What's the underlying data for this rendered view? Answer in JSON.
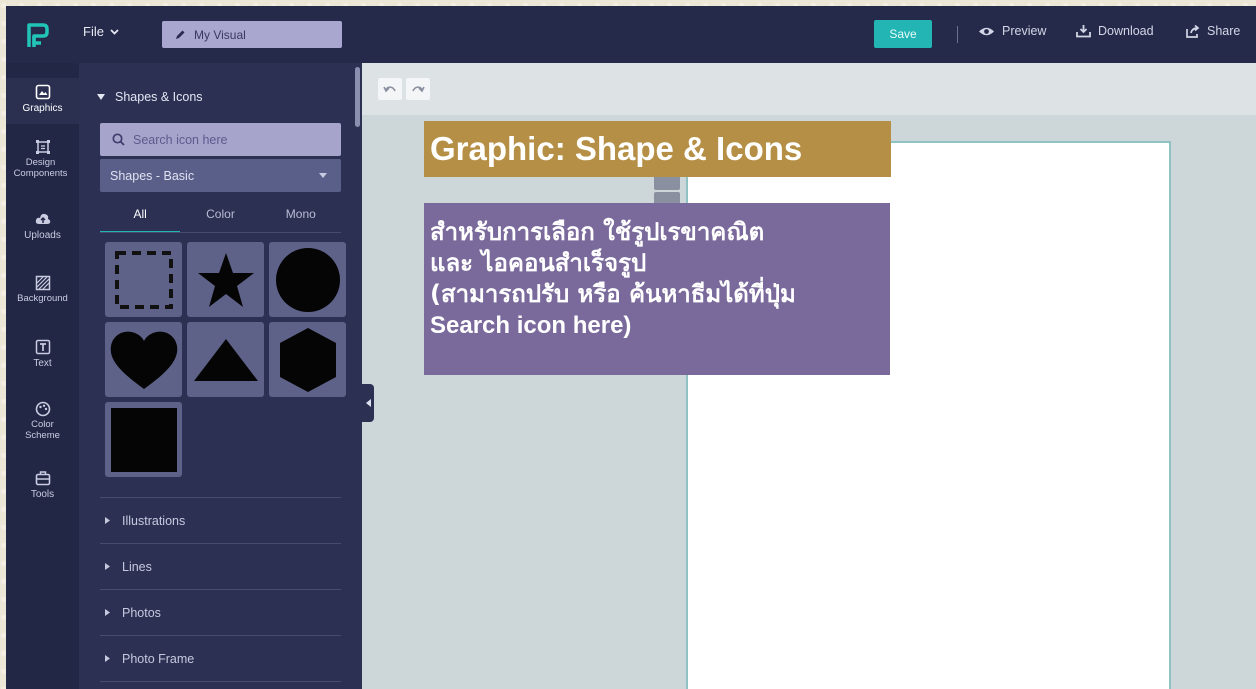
{
  "topbar": {
    "file_label": "File",
    "document_title": "My Visual",
    "save_label": "Save",
    "preview_label": "Preview",
    "download_label": "Download",
    "share_label": "Share"
  },
  "rail": {
    "items": [
      {
        "label": "Graphics",
        "icon": "image-icon"
      },
      {
        "label": "Design Components",
        "icon": "components-icon"
      },
      {
        "label": "Uploads",
        "icon": "cloud-upload-icon"
      },
      {
        "label": "Background",
        "icon": "background-icon"
      },
      {
        "label": "Text",
        "icon": "text-icon"
      },
      {
        "label": "Color Scheme",
        "icon": "palette-icon"
      },
      {
        "label": "Tools",
        "icon": "toolbox-icon"
      }
    ]
  },
  "panel": {
    "section_title": "Shapes & Icons",
    "search_placeholder": "Search icon here",
    "selected_category": "Shapes - Basic",
    "filter_tabs": [
      "All",
      "Color",
      "Mono"
    ],
    "active_filter": "All",
    "shapes": [
      "dashed-square",
      "star",
      "circle",
      "heart",
      "triangle",
      "hexagon",
      "square"
    ],
    "accordion": [
      "Illustrations",
      "Lines",
      "Photos",
      "Photo Frame"
    ]
  },
  "annotation": {
    "title": "Graphic: Shape & Icons",
    "lines": [
      "สำหรับการเลือก ใช้รูปเรขาคณิต",
      "และ ไอคอนสำเร็จรูป",
      "(สามารถปรับ หรือ ค้นหาธีมได้ที่ปุ่ม",
      "Search icon here)"
    ]
  },
  "colors": {
    "topbar_bg": "#252a4a",
    "panel_bg": "#2c3154",
    "accent_teal": "#22b5b4",
    "annotation_gold": "#b58f45",
    "annotation_purple": "#7a6a9c"
  }
}
